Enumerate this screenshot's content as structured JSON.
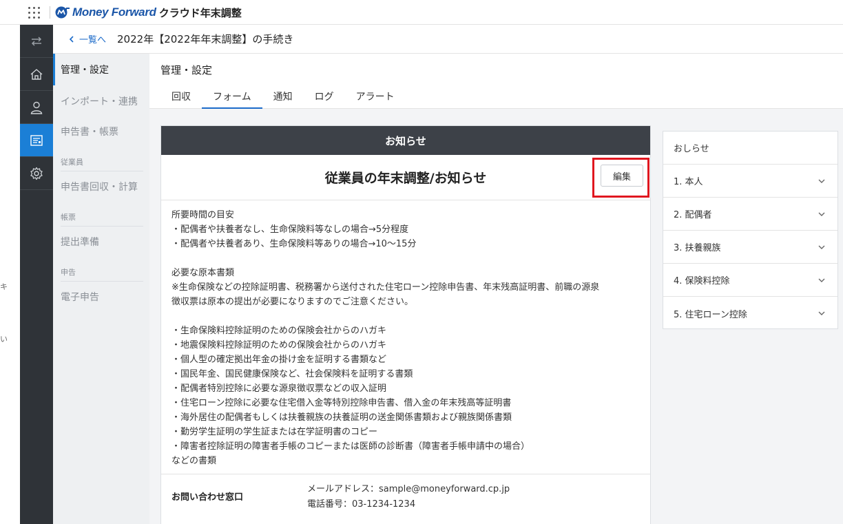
{
  "app": {
    "brand": "Money Forward",
    "product": "クラウド年末調整",
    "brand_color": "#1b56a8",
    "accent_color": "#1b7fd6"
  },
  "edge": {
    "chars": [
      "キ",
      "い"
    ]
  },
  "darkbar": {
    "items": [
      {
        "icon": "switch-arrows-icon"
      },
      {
        "icon": "home-icon"
      },
      {
        "icon": "person-icon"
      },
      {
        "icon": "form-list-icon",
        "active": true
      },
      {
        "icon": "gear-icon"
      }
    ]
  },
  "breadcrumb": {
    "back_label": "一覧へ",
    "title": "2022年【2022年年末調整】の手続き"
  },
  "subnav": {
    "items": {
      "settings": "管理・設定",
      "import": "インポート・連携",
      "forms": "申告書・帳票",
      "collect": "申告書回収・計算",
      "prepare": "提出準備",
      "efile": "電子申告"
    },
    "groups": {
      "employee": "従業員",
      "ledger": "帳票",
      "declaration": "申告"
    }
  },
  "page": {
    "title": "管理・設定",
    "tabs": [
      "回収",
      "フォーム",
      "通知",
      "ログ",
      "アラート"
    ],
    "active_tab": "フォーム"
  },
  "card": {
    "header": "お知らせ",
    "title": "従業員の年末調整/お知らせ",
    "edit_label": "編集",
    "body": {
      "time_heading": "所要時間の目安",
      "time_1": "・配偶者や扶養者なし、生命保険料等なしの場合→5分程度",
      "time_2": "・配偶者や扶養者あり、生命保険料等ありの場合→10〜15分",
      "docs_heading": "必要な原本書類",
      "docs_note_1": "※生命保険などの控除証明書、税務署から送付された住宅ローン控除申告書、年末残高証明書、前職の源泉",
      "docs_note_2": "徴収票は原本の提出が必要になりますのでご注意ください。",
      "list": [
        "・生命保険料控除証明のための保険会社からのハガキ",
        "・地震保険料控除証明のための保険会社からのハガキ",
        "・個人型の確定拠出年金の掛け金を証明する書類など",
        "・国民年金、国民健康保険など、社会保険料を証明する書類",
        "・配偶者特別控除に必要な源泉徴収票などの収入証明",
        "・住宅ローン控除に必要な住宅借入金等特別控除申告書、借入金の年末残高等証明書",
        "・海外居住の配偶者もしくは扶養親族の扶養証明の送金関係書類および親族関係書類",
        "・勤労学生証明の学生証または在学証明書のコピー",
        "・障害者控除証明の障害者手帳のコピーまたは医師の診断書（障害者手帳申請中の場合）"
      ],
      "closing": "などの書類"
    },
    "contact": {
      "label": "お問い合わせ窓口",
      "email_line": "メールアドレス：sample@moneyforward.cp.jp",
      "phone_line": "電話番号：03-1234-1234"
    },
    "highlight_color": "#e0161f"
  },
  "rpanel": {
    "heading": "おしらせ",
    "items": [
      "1. 本人",
      "2. 配偶者",
      "3. 扶養親族",
      "4. 保険料控除",
      "5. 住宅ローン控除"
    ]
  }
}
